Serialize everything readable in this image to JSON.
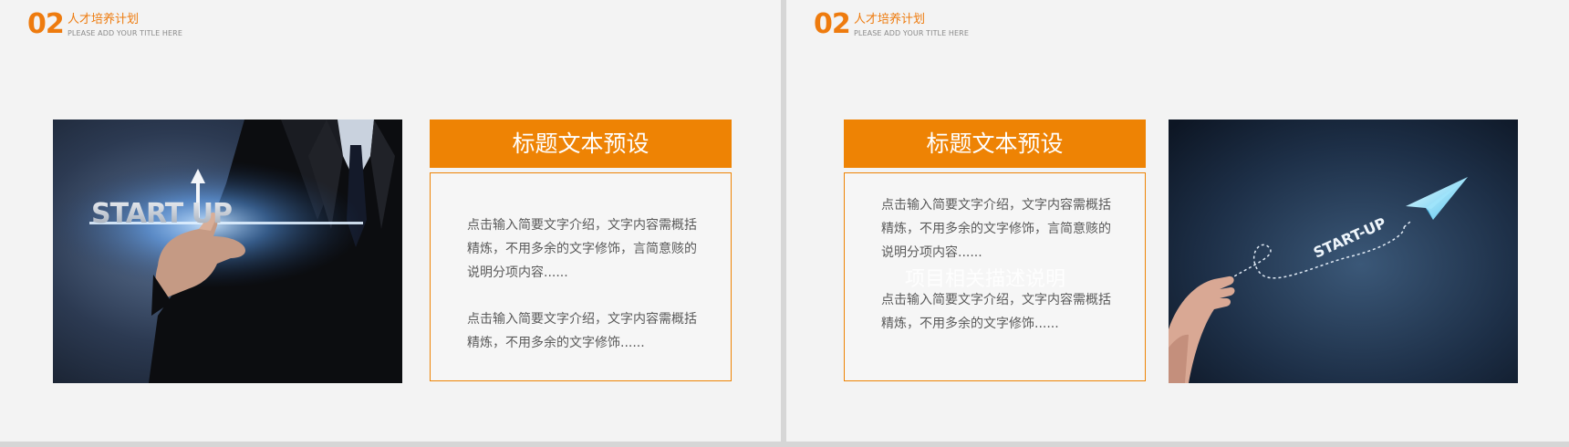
{
  "header": {
    "number": "02",
    "title": "人才培养计划",
    "subtitle": "PLEASE ADD YOUR TITLE HERE"
  },
  "left_slide": {
    "photo_text": "START UP",
    "card": {
      "title": "标题文本预设",
      "paragraph_1": "点击输入简要文字介绍，文字内容需概括精炼，不用多余的文字修饰，言简意赅的说明分项内容......",
      "paragraph_2": "点击输入简要文字介绍，文字内容需概括精炼，不用多余的文字修饰......"
    }
  },
  "right_slide": {
    "photo_text": "START-UP",
    "watermark": "项目相关描述说明",
    "card": {
      "title": "标题文本预设",
      "paragraph_1": "点击输入简要文字介绍，文字内容需概括精炼，不用多余的文字修饰，言简意赅的说明分项内容......",
      "paragraph_2": "点击输入简要文字介绍，文字内容需概括精炼，不用多余的文字修饰......"
    }
  },
  "colors": {
    "accent": "#ee8304",
    "background": "#f3f3f3",
    "body_text": "#5a5a5a"
  }
}
